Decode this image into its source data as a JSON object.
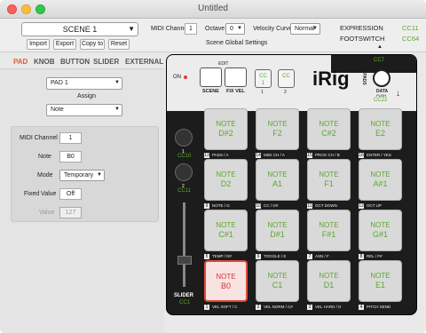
{
  "window": {
    "title": "Untitled"
  },
  "scene": {
    "selected": "SCENE 1",
    "buttons": [
      "Import",
      "Export",
      "Copy to",
      "Reset"
    ],
    "midi_channel_label": "MIDI Channel",
    "midi_channel": "1",
    "octave_label": "Octave",
    "octave": "0",
    "velocity_label": "Velocity Curve",
    "velocity": "Normal",
    "global_label": "Scene Global Settings"
  },
  "expression": {
    "exp_label": "EXPRESSION",
    "exp_cc": "CC11",
    "foot_label": "FOOTSWITCH",
    "foot_cc": "CC64"
  },
  "tabs": [
    "PAD",
    "KNOB",
    "BUTTON",
    "SLIDER",
    "EXTERNAL"
  ],
  "pad_settings": {
    "pad_select": "PAD 1",
    "assign_label": "Assign",
    "assign": "Note",
    "midi_channel_label": "MIDI Channel",
    "midi_channel": "1",
    "note_label": "Note",
    "note": "B0",
    "mode_label": "Mode",
    "mode": "Temporary",
    "fixed_label": "Fixed Value",
    "fixed": "Off",
    "value_label": "Value",
    "value": "127"
  },
  "device": {
    "on_label": "ON",
    "edit_label": "EDIT",
    "scene_btn": "SCENE",
    "fixvel_btn": "FIX VEL",
    "cc20": "CC\n20",
    "cc21": "CC\n21",
    "cc20_num": "1",
    "cc21_num": "2",
    "cc7": "CC7",
    "logo": "iRig",
    "logo_sub": "PADS",
    "data_label": "DATA",
    "push_label": "PUSH",
    "cc22": "CC22",
    "knob1": "CC10",
    "knob1_num": "1",
    "knob2": "CC11",
    "knob2_num": "2",
    "slider_label": "SLIDER",
    "slider_cc": "CC1"
  },
  "pads": [
    {
      "l1": "NOTE",
      "l2": "D#2",
      "num": "13",
      "lbl": "PADS / A"
    },
    {
      "l1": "NOTE",
      "l2": "F2",
      "num": "14",
      "lbl": "MIDI CH / A"
    },
    {
      "l1": "NOTE",
      "l2": "C#2",
      "num": "15",
      "lbl": "PROG CH / B"
    },
    {
      "l1": "NOTE",
      "l2": "E2",
      "num": "16",
      "lbl": "ENTER / YES"
    },
    {
      "l1": "NOTE",
      "l2": "D2",
      "num": "9",
      "lbl": "NOTE / G"
    },
    {
      "l1": "NOTE",
      "l2": "A1",
      "num": "10",
      "lbl": "CC / G#"
    },
    {
      "l1": "NOTE",
      "l2": "F1",
      "num": "11",
      "lbl": "OCT DOWN"
    },
    {
      "l1": "NOTE",
      "l2": "A#1",
      "num": "12",
      "lbl": "OCT UP"
    },
    {
      "l1": "NOTE",
      "l2": "C#1",
      "num": "5",
      "lbl": "TEMP / D#"
    },
    {
      "l1": "NOTE",
      "l2": "D#1",
      "num": "6",
      "lbl": "TOGGLE / E"
    },
    {
      "l1": "NOTE",
      "l2": "F#1",
      "num": "7",
      "lbl": "ASN / F"
    },
    {
      "l1": "NOTE",
      "l2": "G#1",
      "num": "8",
      "lbl": "REL / F#"
    },
    {
      "l1": "NOTE",
      "l2": "B0",
      "num": "1",
      "lbl": "VEL SOFT / C"
    },
    {
      "l1": "NOTE",
      "l2": "C1",
      "num": "2",
      "lbl": "VEL NORM / C#"
    },
    {
      "l1": "NOTE",
      "l2": "D1",
      "num": "3",
      "lbl": "VEL HARD / D"
    },
    {
      "l1": "NOTE",
      "l2": "E1",
      "num": "4",
      "lbl": "PITCH SEND"
    }
  ]
}
